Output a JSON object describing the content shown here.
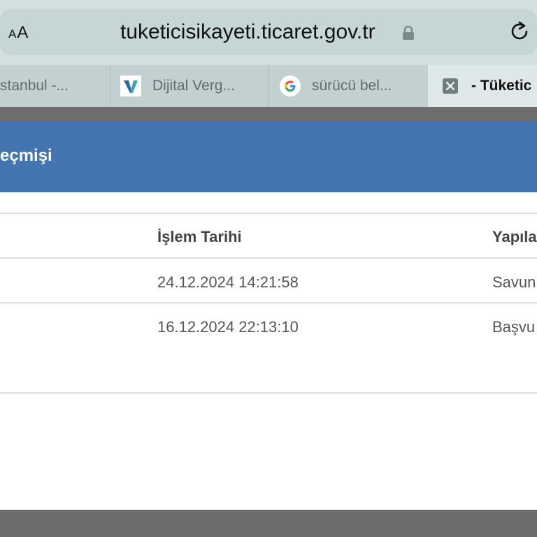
{
  "browser": {
    "text_size_label_small": "A",
    "text_size_label_large": "A",
    "url": "tuketicisikayeti.ticaret.gov.tr",
    "icons": {
      "lock": "lock-icon",
      "reload": "reload-icon"
    }
  },
  "tabs": [
    {
      "label": "stanbul -..."
    },
    {
      "label": "Dijital Verg..."
    },
    {
      "label": "sürücü bel..."
    },
    {
      "label": "- Tüketic"
    }
  ],
  "modal": {
    "title": "eçmişi",
    "header_color": "#4475b0",
    "table": {
      "columns": [
        "İşlem Tarihi",
        "Yapıla"
      ],
      "rows": [
        {
          "date": "24.12.2024 14:21:58",
          "action": "Savun"
        },
        {
          "date": "16.12.2024 22:13:10",
          "action": "Başvu"
        }
      ]
    }
  }
}
